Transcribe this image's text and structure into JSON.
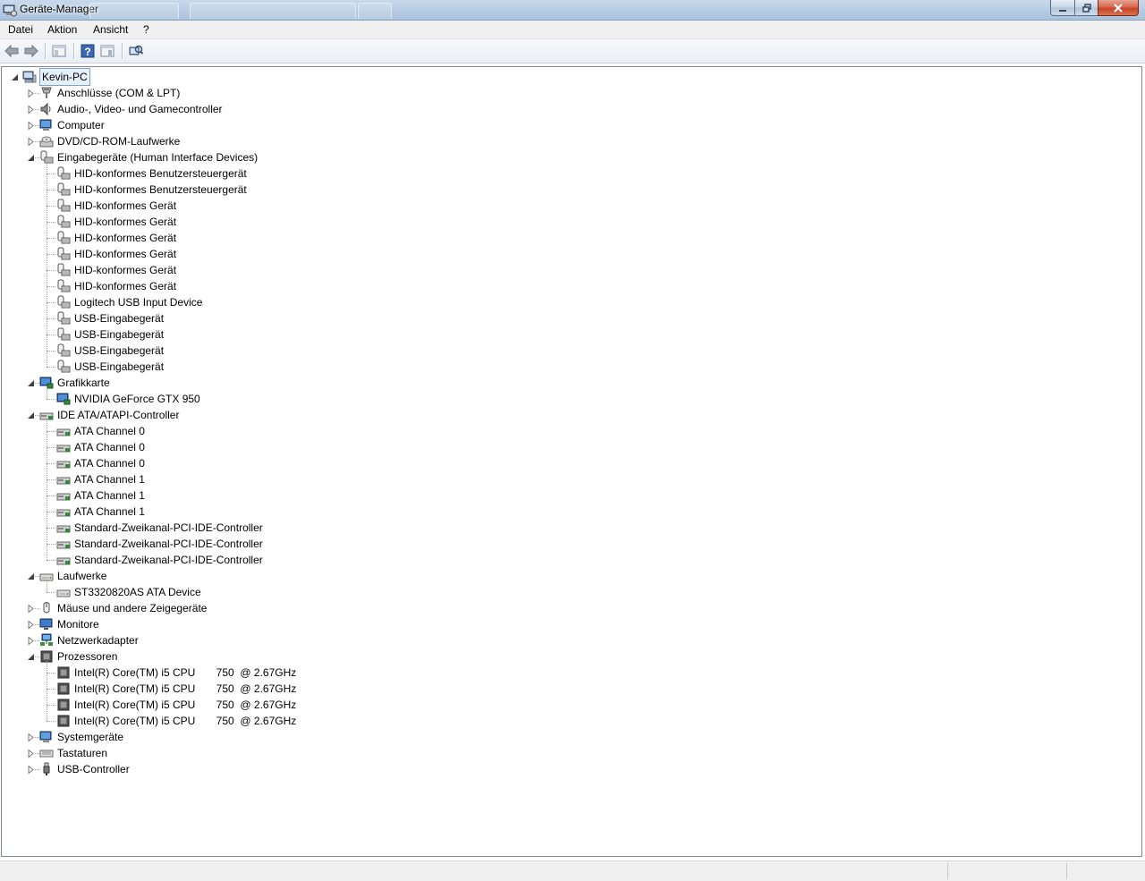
{
  "window": {
    "title": "Geräte-Manager",
    "accent": "#b7cde3"
  },
  "menu": {
    "file": "Datei",
    "action": "Aktion",
    "view": "Ansicht",
    "help": "?"
  },
  "tree": {
    "root": "Kevin-PC",
    "categories": [
      {
        "label": "Anschlüsse (COM & LPT)",
        "icon": "port-icon",
        "expanded": false
      },
      {
        "label": "Audio-, Video- und Gamecontroller",
        "icon": "speaker-icon",
        "expanded": false
      },
      {
        "label": "Computer",
        "icon": "computer-icon",
        "expanded": false
      },
      {
        "label": "DVD/CD-ROM-Laufwerke",
        "icon": "dvd-drive-icon",
        "expanded": false
      },
      {
        "label": "Eingabegeräte (Human Interface Devices)",
        "icon": "hid-icon",
        "expanded": true,
        "children": [
          "HID-konformes Benutzersteuergerät",
          "HID-konformes Benutzersteuergerät",
          "HID-konformes Gerät",
          "HID-konformes Gerät",
          "HID-konformes Gerät",
          "HID-konformes Gerät",
          "HID-konformes Gerät",
          "HID-konformes Gerät",
          "Logitech USB Input Device",
          "USB-Eingabegerät",
          "USB-Eingabegerät",
          "USB-Eingabegerät",
          "USB-Eingabegerät"
        ],
        "child_icon": "hid-icon"
      },
      {
        "label": "Grafikkarte",
        "icon": "display-adapter-icon",
        "expanded": true,
        "children": [
          "NVIDIA GeForce GTX 950"
        ],
        "child_icon": "display-adapter-icon"
      },
      {
        "label": "IDE ATA/ATAPI-Controller",
        "icon": "ide-controller-icon",
        "expanded": true,
        "children": [
          "ATA Channel 0",
          "ATA Channel 0",
          "ATA Channel 0",
          "ATA Channel 1",
          "ATA Channel 1",
          "ATA Channel 1",
          "Standard-Zweikanal-PCI-IDE-Controller",
          "Standard-Zweikanal-PCI-IDE-Controller",
          "Standard-Zweikanal-PCI-IDE-Controller"
        ],
        "child_icon": "ide-controller-icon"
      },
      {
        "label": "Laufwerke",
        "icon": "disk-drive-icon",
        "expanded": true,
        "children": [
          "ST3320820AS ATA Device"
        ],
        "child_icon": "disk-drive-icon"
      },
      {
        "label": "Mäuse und andere Zeigegeräte",
        "icon": "mouse-icon",
        "expanded": false
      },
      {
        "label": "Monitore",
        "icon": "monitor-icon",
        "expanded": false
      },
      {
        "label": "Netzwerkadapter",
        "icon": "network-adapter-icon",
        "expanded": false
      },
      {
        "label": "Prozessoren",
        "icon": "processor-icon",
        "expanded": true,
        "children": [
          "Intel(R) Core(TM) i5 CPU       750  @ 2.67GHz",
          "Intel(R) Core(TM) i5 CPU       750  @ 2.67GHz",
          "Intel(R) Core(TM) i5 CPU       750  @ 2.67GHz",
          "Intel(R) Core(TM) i5 CPU       750  @ 2.67GHz"
        ],
        "child_icon": "processor-icon"
      },
      {
        "label": "Systemgeräte",
        "icon": "system-devices-icon",
        "expanded": false
      },
      {
        "label": "Tastaturen",
        "icon": "keyboard-icon",
        "expanded": false
      },
      {
        "label": "USB-Controller",
        "icon": "usb-icon",
        "expanded": false
      }
    ]
  }
}
